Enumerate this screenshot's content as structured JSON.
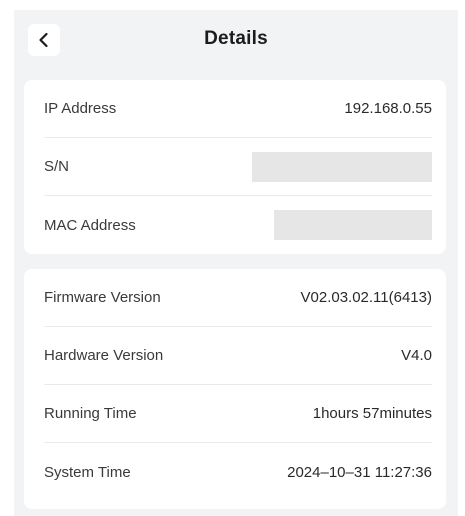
{
  "header": {
    "title": "Details",
    "back_icon": "chevron-left-icon"
  },
  "network_card": {
    "rows": [
      {
        "label": "IP Address",
        "value": "192.168.0.55"
      },
      {
        "label": "S/N",
        "value": null,
        "redacted": true
      },
      {
        "label": "MAC Address",
        "value": null,
        "redacted": true
      }
    ]
  },
  "device_card": {
    "rows": [
      {
        "label": "Firmware Version",
        "value": "V02.03.02.11(6413)"
      },
      {
        "label": "Hardware Version",
        "value": "V4.0"
      },
      {
        "label": "Running Time",
        "value": "1hours 57minutes"
      },
      {
        "label": "System Time",
        "value": "2024–10–31 11:27:36"
      }
    ]
  },
  "colors": {
    "background": "#f2f3f5",
    "card": "#ffffff",
    "redaction": "#e6e6e6",
    "divider": "#e9eaec"
  }
}
